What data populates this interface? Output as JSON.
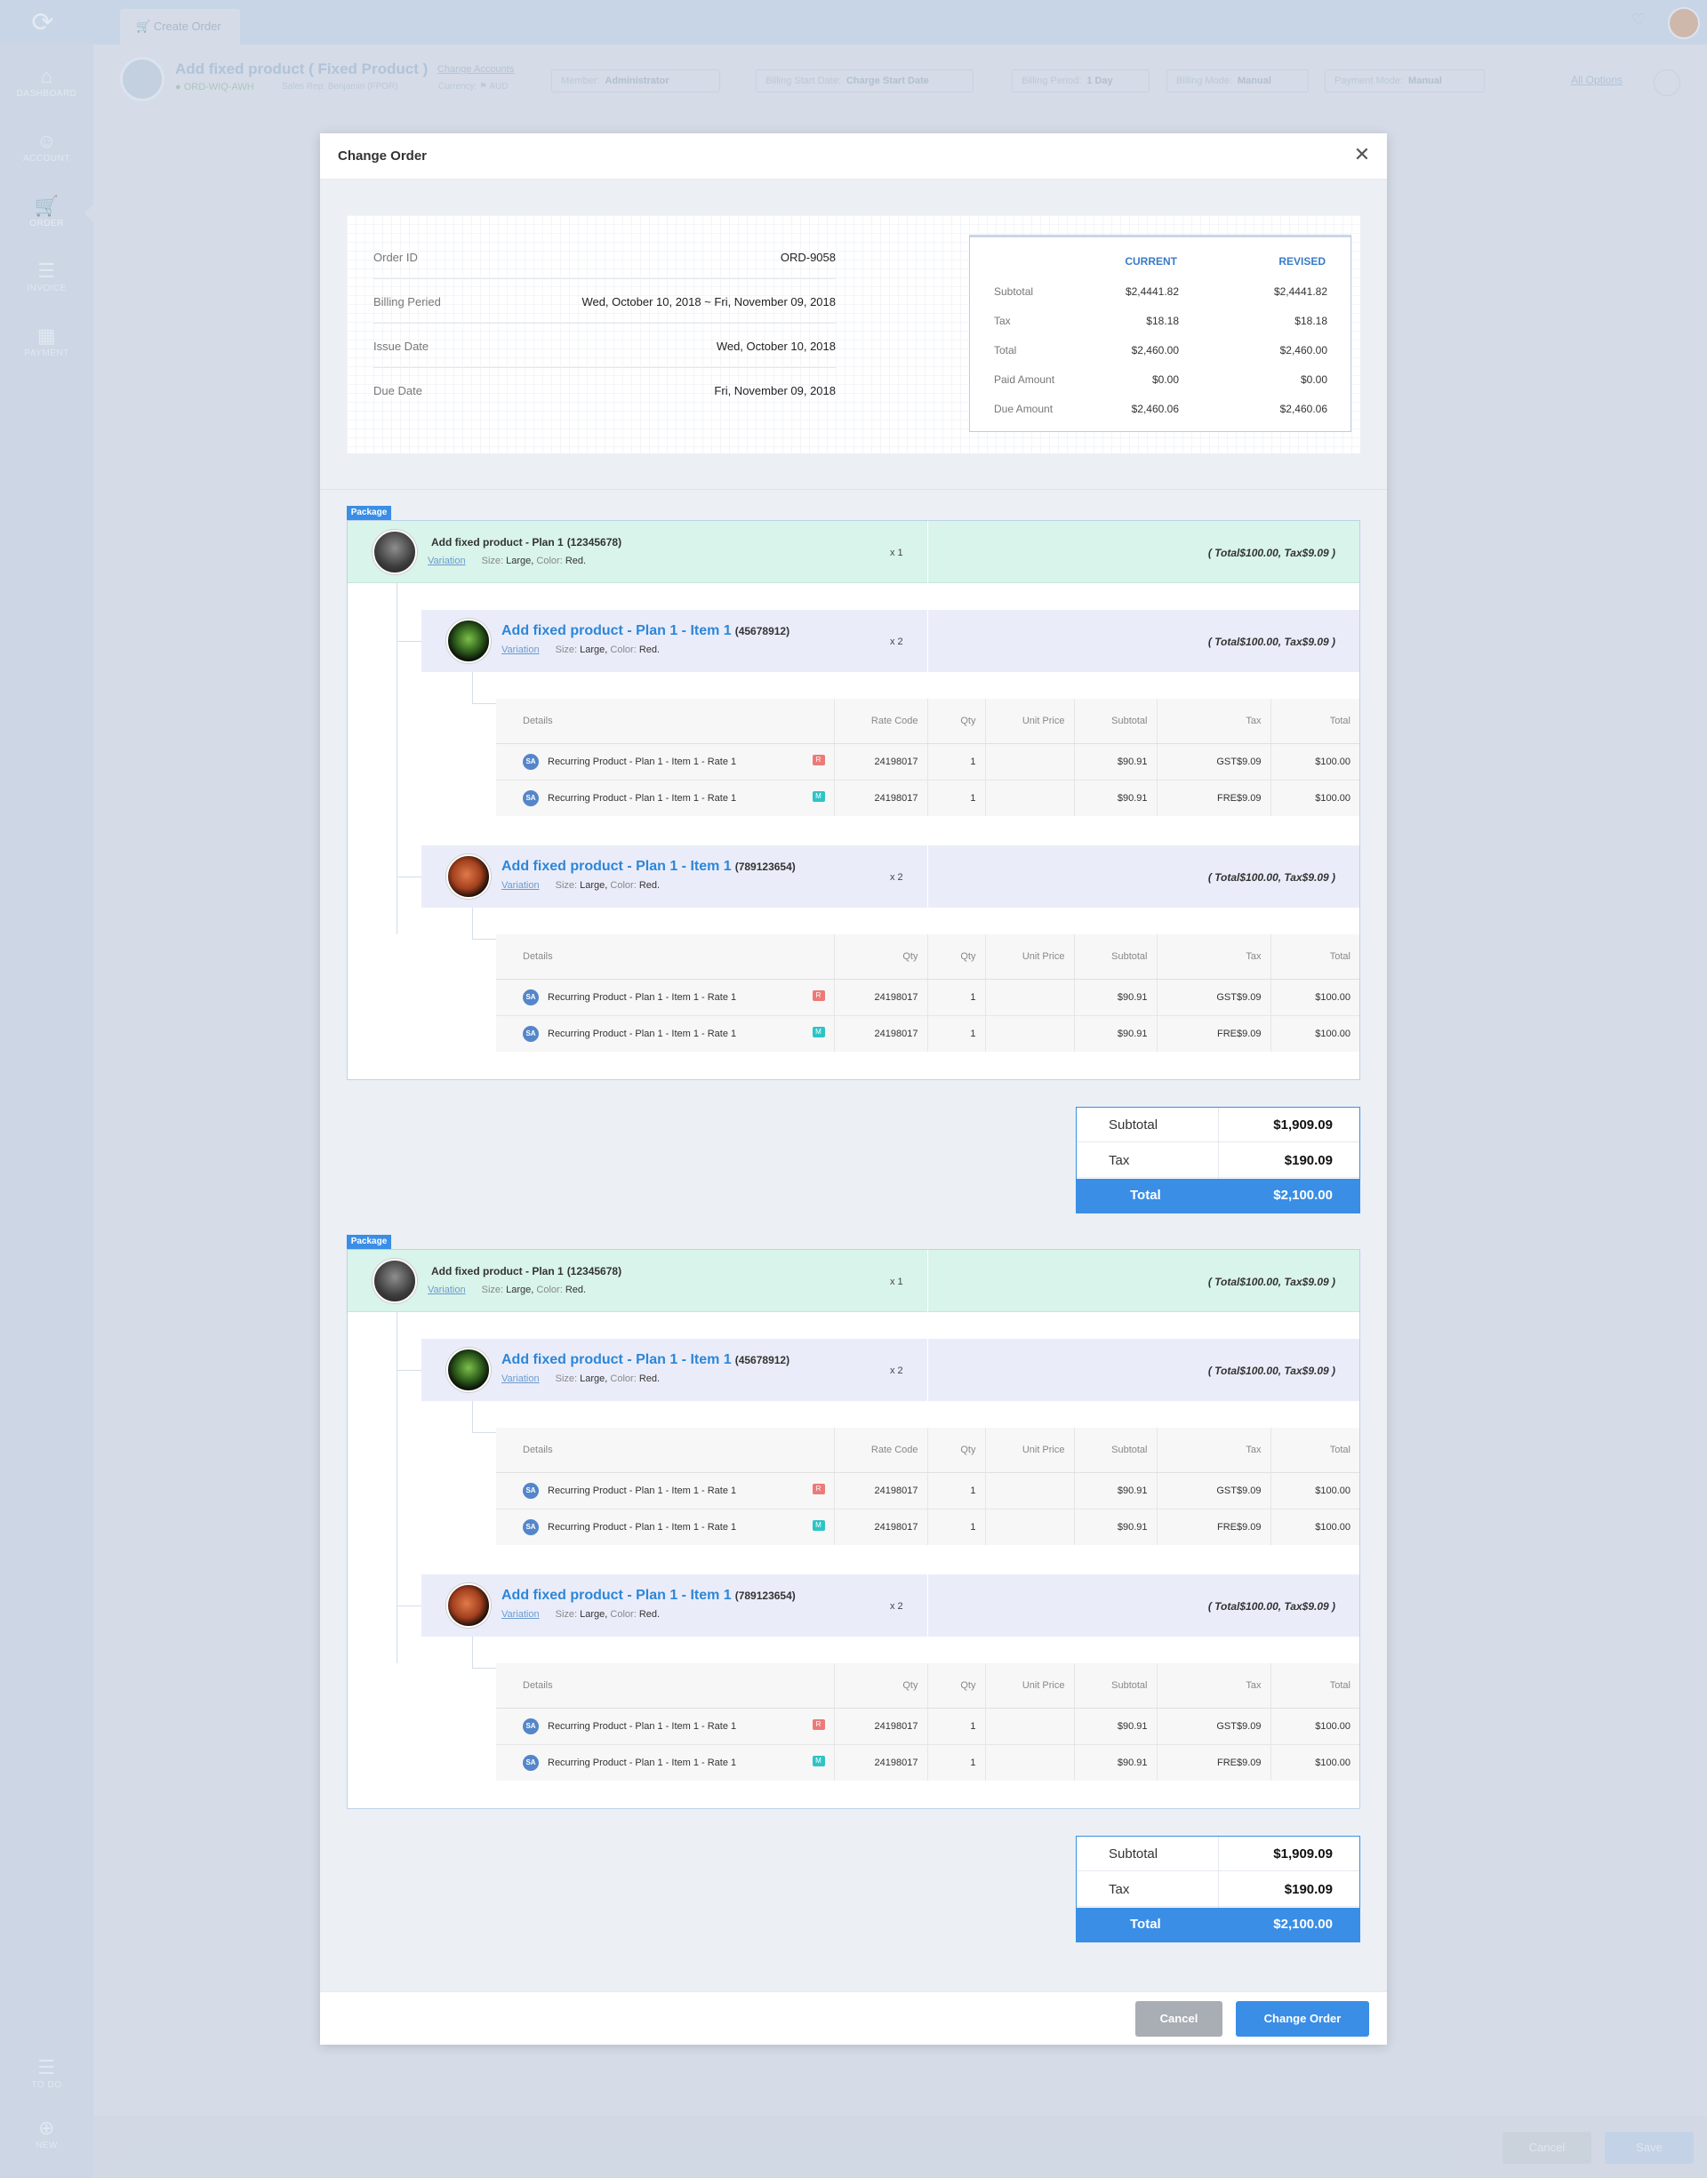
{
  "topbar": {
    "tab_label": "Create Order",
    "tab_icon": "cart-icon",
    "bell_icon": "bell-icon"
  },
  "sidebar": {
    "items": [
      {
        "label": "DASHBOARD",
        "icon": "home-icon"
      },
      {
        "label": "ACCOUNT",
        "icon": "user-icon"
      },
      {
        "label": "ORDER",
        "icon": "cart-icon"
      },
      {
        "label": "INVOICE",
        "icon": "invoice-icon"
      },
      {
        "label": "PAYMENT",
        "icon": "payment-icon"
      }
    ],
    "bottom": [
      {
        "label": "TO DO",
        "icon": "list-icon"
      },
      {
        "label": "NEW",
        "icon": "plus-icon"
      }
    ]
  },
  "header": {
    "title": "Add fixed product ( Fixed Product )",
    "change_accounts": "Change Accounts",
    "order_id": "ORD-WIQ-AWH",
    "sub_label": "Sales Rep: Benjamin (FPOR)",
    "currency_label": "Currency:",
    "currency_value": "AUD",
    "selects": [
      {
        "label": "Member:",
        "value": "Administrator"
      },
      {
        "label": "Billing Start Date:",
        "value": "Charge Start Date"
      },
      {
        "label": "Billing Period:",
        "value": "1 Day"
      },
      {
        "label": "Billing Mode:",
        "value": "Manual"
      },
      {
        "label": "Payment Mode:",
        "value": "Manual"
      }
    ],
    "all_options": "All Options"
  },
  "footer": {
    "cancel": "Cancel",
    "save": "Save"
  },
  "modal": {
    "title": "Change Order",
    "info": [
      {
        "label": "Order ID",
        "value": "ORD-9058"
      },
      {
        "label": "Billing Peried",
        "value": "Wed, October 10, 2018 ~ Fri, November 09, 2018"
      },
      {
        "label": "Issue Date",
        "value": "Wed, October 10, 2018"
      },
      {
        "label": "Due Date",
        "value": "Fri, November 09, 2018"
      }
    ],
    "summary": {
      "current_label": "CURRENT",
      "revised_label": "REVISED",
      "rows": [
        {
          "label": "Subtotal",
          "current": "$2,4441.82",
          "revised": "$2,4441.82"
        },
        {
          "label": "Tax",
          "current": "$18.18",
          "revised": "$18.18"
        },
        {
          "label": "Total",
          "current": "$2,460.00",
          "revised": "$2,460.00"
        },
        {
          "label": "Paid Amount",
          "current": "$0.00",
          "revised": "$0.00"
        },
        {
          "label": "Due Amount",
          "current": "$2,460.06",
          "revised": "$2,460.06"
        }
      ]
    },
    "packages": [
      {
        "tag": "Package",
        "plan": {
          "name": "Add fixed product - Plan 1",
          "code": "(12345678)",
          "variation": "Variation",
          "size_label": "Size:",
          "size": "Large,",
          "color_label": "Color:",
          "color": "Red.",
          "qty": "x 1",
          "total": "( Total$100.00, Tax$9.09 )"
        },
        "items": [
          {
            "name": "Add fixed product - Plan 1 - Item 1",
            "code": "(45678912)",
            "variation": "Variation",
            "size_label": "Size:",
            "size": "Large,",
            "color_label": "Color:",
            "color": "Red.",
            "qty": "x 2",
            "total": "( Total$100.00, Tax$9.09 )",
            "columns": [
              "Details",
              "Rate Code",
              "Qty",
              "Unit Price",
              "Subtotal",
              "Tax",
              "Total"
            ],
            "rows": [
              {
                "avatar": "SA",
                "detail": "Recurring Product - Plan 1 - Item 1 - Rate 1",
                "badge": "R",
                "rate_code": "24198017",
                "qty": "1",
                "unit_price": "",
                "subtotal": "$90.91",
                "tax_code": "GST",
                "tax": "$9.09",
                "total": "$100.00"
              },
              {
                "avatar": "SA",
                "detail": "Recurring Product - Plan 1 - Item 1 - Rate 1",
                "badge": "M",
                "rate_code": "24198017",
                "qty": "1",
                "unit_price": "",
                "subtotal": "$90.91",
                "tax_code": "FRE",
                "tax": "$9.09",
                "total": "$100.00"
              }
            ]
          },
          {
            "name": "Add fixed product - Plan 1 - Item 1",
            "code": "(789123654)",
            "variation": "Variation",
            "size_label": "Size:",
            "size": "Large,",
            "color_label": "Color:",
            "color": "Red.",
            "qty": "x 2",
            "total": "( Total$100.00, Tax$9.09 )",
            "columns": [
              "Details",
              "Qty",
              "Qty",
              "Unit Price",
              "Subtotal",
              "Tax",
              "Total"
            ],
            "rows": [
              {
                "avatar": "SA",
                "detail": "Recurring Product - Plan 1 - Item 1 - Rate 1",
                "badge": "R",
                "rate_code": "24198017",
                "qty": "1",
                "unit_price": "",
                "subtotal": "$90.91",
                "tax_code": "GST",
                "tax": "$9.09",
                "total": "$100.00"
              },
              {
                "avatar": "SA",
                "detail": "Recurring Product - Plan 1 - Item 1 - Rate 1",
                "badge": "M",
                "rate_code": "24198017",
                "qty": "1",
                "unit_price": "",
                "subtotal": "$90.91",
                "tax_code": "FRE",
                "tax": "$9.09",
                "total": "$100.00"
              }
            ]
          }
        ],
        "totals": {
          "subtotal_label": "Subtotal",
          "subtotal": "$1,909.09",
          "tax_label": "Tax",
          "tax": "$190.09",
          "total_label": "Total",
          "total": "$2,100.00"
        }
      },
      {
        "tag": "Package",
        "plan": {
          "name": "Add fixed product - Plan 1",
          "code": "(12345678)",
          "variation": "Variation",
          "size_label": "Size:",
          "size": "Large,",
          "color_label": "Color:",
          "color": "Red.",
          "qty": "x 1",
          "total": "( Total$100.00, Tax$9.09 )"
        },
        "items": [
          {
            "name": "Add fixed product - Plan 1 - Item 1",
            "code": "(45678912)",
            "variation": "Variation",
            "size_label": "Size:",
            "size": "Large,",
            "color_label": "Color:",
            "color": "Red.",
            "qty": "x 2",
            "total": "( Total$100.00, Tax$9.09 )",
            "columns": [
              "Details",
              "Rate Code",
              "Qty",
              "Unit Price",
              "Subtotal",
              "Tax",
              "Total"
            ],
            "rows": [
              {
                "avatar": "SA",
                "detail": "Recurring Product - Plan 1 - Item 1 - Rate 1",
                "badge": "R",
                "rate_code": "24198017",
                "qty": "1",
                "unit_price": "",
                "subtotal": "$90.91",
                "tax_code": "GST",
                "tax": "$9.09",
                "total": "$100.00"
              },
              {
                "avatar": "SA",
                "detail": "Recurring Product - Plan 1 - Item 1 - Rate 1",
                "badge": "M",
                "rate_code": "24198017",
                "qty": "1",
                "unit_price": "",
                "subtotal": "$90.91",
                "tax_code": "FRE",
                "tax": "$9.09",
                "total": "$100.00"
              }
            ]
          },
          {
            "name": "Add fixed product - Plan 1 - Item 1",
            "code": "(789123654)",
            "variation": "Variation",
            "size_label": "Size:",
            "size": "Large,",
            "color_label": "Color:",
            "color": "Red.",
            "qty": "x 2",
            "total": "( Total$100.00, Tax$9.09 )",
            "columns": [
              "Details",
              "Qty",
              "Qty",
              "Unit Price",
              "Subtotal",
              "Tax",
              "Total"
            ],
            "rows": [
              {
                "avatar": "SA",
                "detail": "Recurring Product - Plan 1 - Item 1 - Rate 1",
                "badge": "R",
                "rate_code": "24198017",
                "qty": "1",
                "unit_price": "",
                "subtotal": "$90.91",
                "tax_code": "GST",
                "tax": "$9.09",
                "total": "$100.00"
              },
              {
                "avatar": "SA",
                "detail": "Recurring Product - Plan 1 - Item 1 - Rate 1",
                "badge": "M",
                "rate_code": "24198017",
                "qty": "1",
                "unit_price": "",
                "subtotal": "$90.91",
                "tax_code": "FRE",
                "tax": "$9.09",
                "total": "$100.00"
              }
            ]
          }
        ],
        "totals": {
          "subtotal_label": "Subtotal",
          "subtotal": "$1,909.09",
          "tax_label": "Tax",
          "tax": "$190.09",
          "total_label": "Total",
          "total": "$2,100.00"
        }
      }
    ],
    "buttons": {
      "cancel": "Cancel",
      "change_order": "Change Order"
    },
    "close_icon": "close-icon"
  },
  "colors": {
    "accent": "#3a8ee6",
    "plan_bg": "#d9f4ea",
    "item_bg": "#eaedf9",
    "badge_r": "#ec7a78",
    "badge_m": "#2ec4c6",
    "cancel_btn": "#a9adb4"
  }
}
